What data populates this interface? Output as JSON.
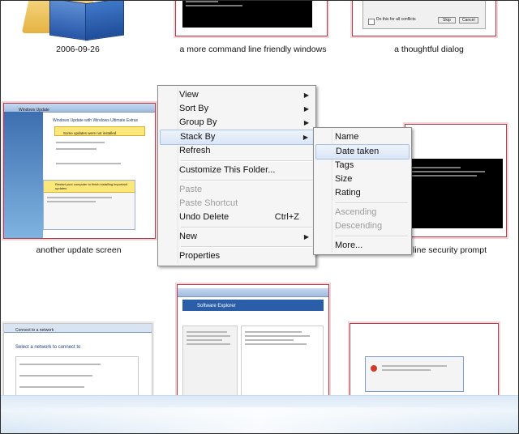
{
  "thumbnails": {
    "top_left": {
      "caption": "2006-09-26"
    },
    "top_middle": {
      "caption": "a more command line friendly windows"
    },
    "top_right": {
      "caption": "a thoughtful dialog"
    },
    "mid_left": {
      "caption": "another update screen"
    },
    "mid_right": {
      "caption": "line security prompt"
    },
    "bottom_left": {},
    "bottom_middle": {},
    "bottom_right": {}
  },
  "dialog_thumb": {
    "checkbox_label": "Do this for all conflicts",
    "skip": "Skip",
    "cancel": "Cancel"
  },
  "update_thumb": {
    "title": "Windows Update",
    "heading": "Windows Update with Windows Ultimate Extras",
    "notice": "Some updates were not installed",
    "dialog_title": "Restart your computer to finish installing important updates"
  },
  "explorer_thumb": {
    "title": "Software Explorer"
  },
  "network_thumb": {
    "title": "Connect to a network",
    "heading": "Select a network to connect to"
  },
  "context_menu": {
    "items": [
      {
        "label": "View",
        "submenu": true
      },
      {
        "label": "Sort By",
        "submenu": true
      },
      {
        "label": "Group By",
        "submenu": true
      },
      {
        "label": "Stack By",
        "submenu": true,
        "active": true
      },
      {
        "label": "Refresh"
      },
      {
        "label": "Customize This Folder..."
      },
      {
        "label": "Paste",
        "disabled": true
      },
      {
        "label": "Paste Shortcut",
        "disabled": true
      },
      {
        "label": "Undo Delete",
        "shortcut": "Ctrl+Z"
      },
      {
        "label": "New",
        "submenu": true
      },
      {
        "label": "Properties"
      }
    ]
  },
  "stack_by_submenu": {
    "items": [
      {
        "label": "Name"
      },
      {
        "label": "Date taken",
        "highlighted": true
      },
      {
        "label": "Tags"
      },
      {
        "label": "Size"
      },
      {
        "label": "Rating"
      },
      {
        "label": "Ascending",
        "disabled": true
      },
      {
        "label": "Descending",
        "disabled": true
      },
      {
        "label": "More..."
      }
    ]
  },
  "colors": {
    "menu_bg": "#f5f5f5",
    "highlight": "#d9e6f7",
    "thumb_border": "#b33b4b"
  }
}
